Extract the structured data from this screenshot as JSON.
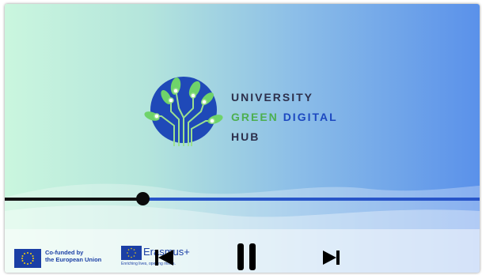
{
  "video": {
    "progress_fraction": 0.29,
    "colors": {
      "played": "#111111",
      "remaining": "#2855c8",
      "gradient_start": "#caf6de",
      "gradient_end": "#5a91ea"
    }
  },
  "logo": {
    "line1": "UNIVERSITY",
    "line2_a": "GREEN",
    "line2_b": "DIGITAL",
    "line3": "HUB",
    "icon": "circuit-leaves-globe",
    "colors": {
      "dark": "#2d2f4b",
      "green": "#4caf50",
      "blue": "#1c48c0"
    }
  },
  "footer": {
    "eu_line1": "Co-funded by",
    "eu_line2": "the European Union",
    "erasmus_name": "Erasmus+",
    "erasmus_tagline": "Enriching lives, opening minds."
  },
  "controls": {
    "previous_icon": "skip-previous-icon",
    "pause_icon": "pause-icon",
    "next_icon": "skip-next-icon"
  }
}
